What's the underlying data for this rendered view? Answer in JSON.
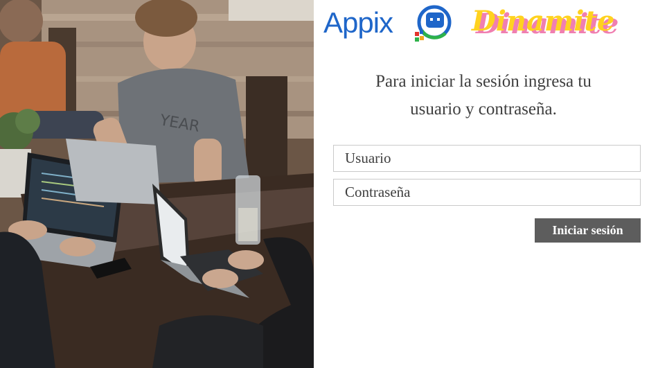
{
  "branding": {
    "appix_name": "Appix",
    "dinamite_name": "Dinamite"
  },
  "login": {
    "prompt_line1": "Para iniciar la sesión ingresa tu",
    "prompt_line2": "usuario y contraseña.",
    "username_placeholder": "Usuario",
    "password_placeholder": "Contraseña",
    "submit_label": "Iniciar sesión"
  },
  "colors": {
    "appix_blue": "#1f66c9",
    "dinamite_yellow": "#ffd21f",
    "dinamite_pink": "#f07fb0",
    "button_bg": "#5d5d5d"
  },
  "photo": {
    "subject": "people-working-on-laptops-at-table"
  }
}
